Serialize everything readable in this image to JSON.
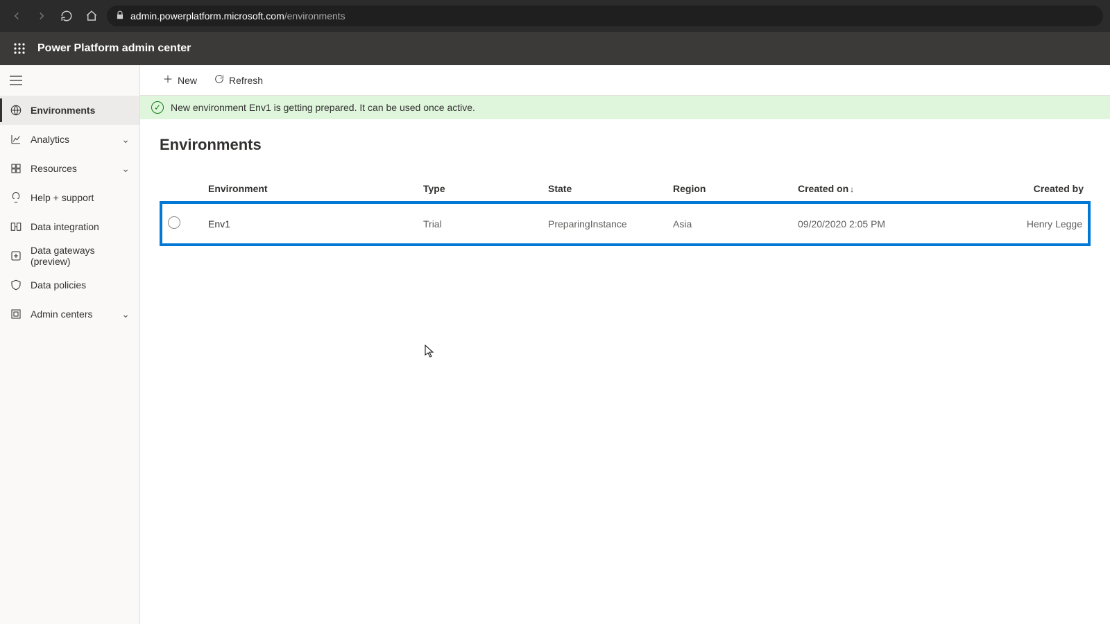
{
  "browser": {
    "url_domain": "admin.powerplatform.microsoft.com",
    "url_path": "/environments"
  },
  "header": {
    "app_title": "Power Platform admin center"
  },
  "sidebar": {
    "items": [
      {
        "label": "Environments",
        "icon": "environments",
        "active": true,
        "expandable": false
      },
      {
        "label": "Analytics",
        "icon": "analytics",
        "active": false,
        "expandable": true
      },
      {
        "label": "Resources",
        "icon": "resources",
        "active": false,
        "expandable": true
      },
      {
        "label": "Help + support",
        "icon": "help",
        "active": false,
        "expandable": false
      },
      {
        "label": "Data integration",
        "icon": "data-integration",
        "active": false,
        "expandable": false
      },
      {
        "label": "Data gateways (preview)",
        "icon": "data-gateways",
        "active": false,
        "expandable": false
      },
      {
        "label": "Data policies",
        "icon": "data-policies",
        "active": false,
        "expandable": false
      },
      {
        "label": "Admin centers",
        "icon": "admin-centers",
        "active": false,
        "expandable": true
      }
    ]
  },
  "cmdbar": {
    "new_label": "New",
    "refresh_label": "Refresh"
  },
  "info_banner": "New environment Env1 is getting prepared. It can be used once active.",
  "page_title": "Environments",
  "table": {
    "columns": {
      "environment": "Environment",
      "type": "Type",
      "state": "State",
      "region": "Region",
      "created_on": "Created on",
      "created_by": "Created by"
    },
    "sort_indicator": "↓",
    "rows": [
      {
        "name": "Env1",
        "type": "Trial",
        "state": "PreparingInstance",
        "region": "Asia",
        "created_on": "09/20/2020 2:05 PM",
        "created_by": "Henry Legge"
      }
    ]
  }
}
